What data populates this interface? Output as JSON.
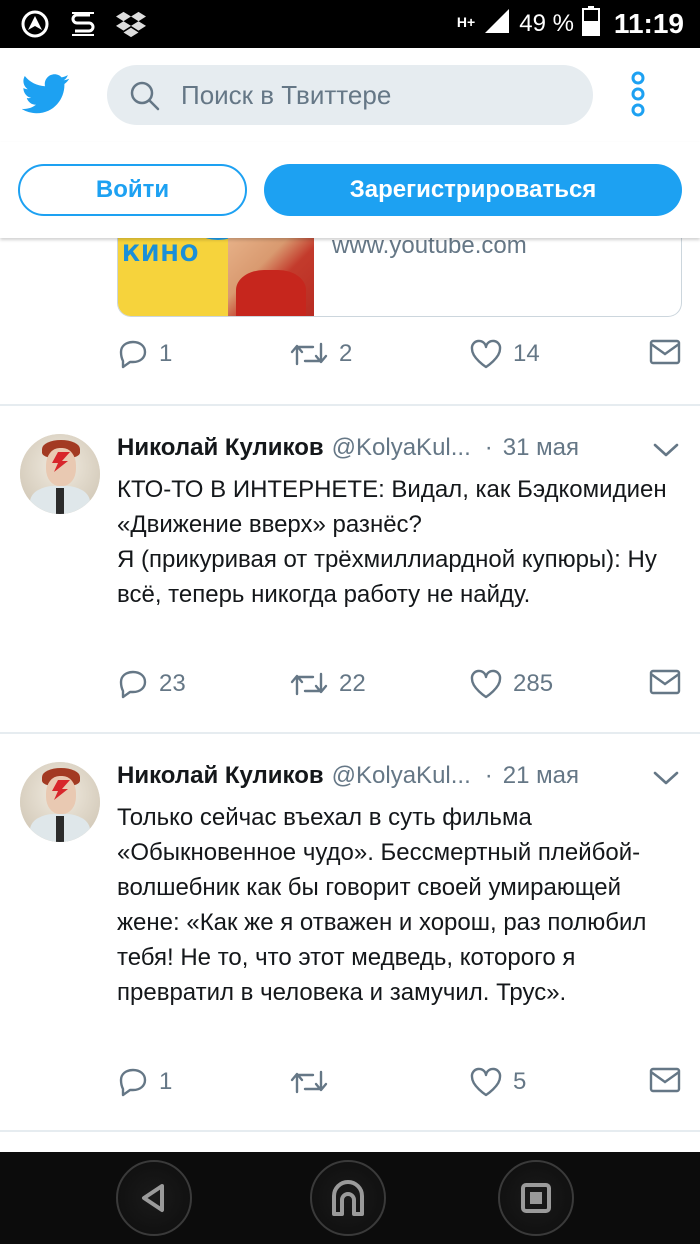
{
  "status_bar": {
    "network": "H+",
    "battery": "49 %",
    "time": "11:19"
  },
  "header": {
    "search_placeholder": "Поиск в Твиттере"
  },
  "auth": {
    "login_label": "Войти",
    "signup_label": "Зарегистрироваться"
  },
  "prev_tweet": {
    "card_thumb_text": "КИНО",
    "card_domain": "www.youtube.com",
    "replies": "1",
    "retweets": "2",
    "likes": "14"
  },
  "tweets": [
    {
      "author": "Николай Куликов",
      "handle": "@KolyaKul...",
      "separator": "·",
      "date": "31 мая",
      "text": "КТО-ТО В ИНТЕРНЕТЕ: Видал, как Бэдкомидиен «Движение вверх» разнёс?\nЯ (прикуривая от трёхмиллиардной купюры): Ну всё, теперь никогда работу не найду.",
      "replies": "23",
      "retweets": "22",
      "likes": "285"
    },
    {
      "author": "Николай Куликов",
      "handle": "@KolyaKul...",
      "separator": "·",
      "date": "21 мая",
      "text": "Только сейчас въехал в суть фильма «Обыкновенное чудо». Бессмертный плейбой-волшебник как бы говорит своей умирающей жене: «Как же я отважен и хорош, раз полюбил тебя! Не то, что этот медведь, которого я превратил в человека и замучил. Трус».",
      "replies": "1",
      "retweets": "",
      "likes": "5"
    }
  ],
  "colors": {
    "brand": "#1da1f2",
    "muted": "#657786",
    "text": "#14171a",
    "divider": "#e6ecf0"
  }
}
